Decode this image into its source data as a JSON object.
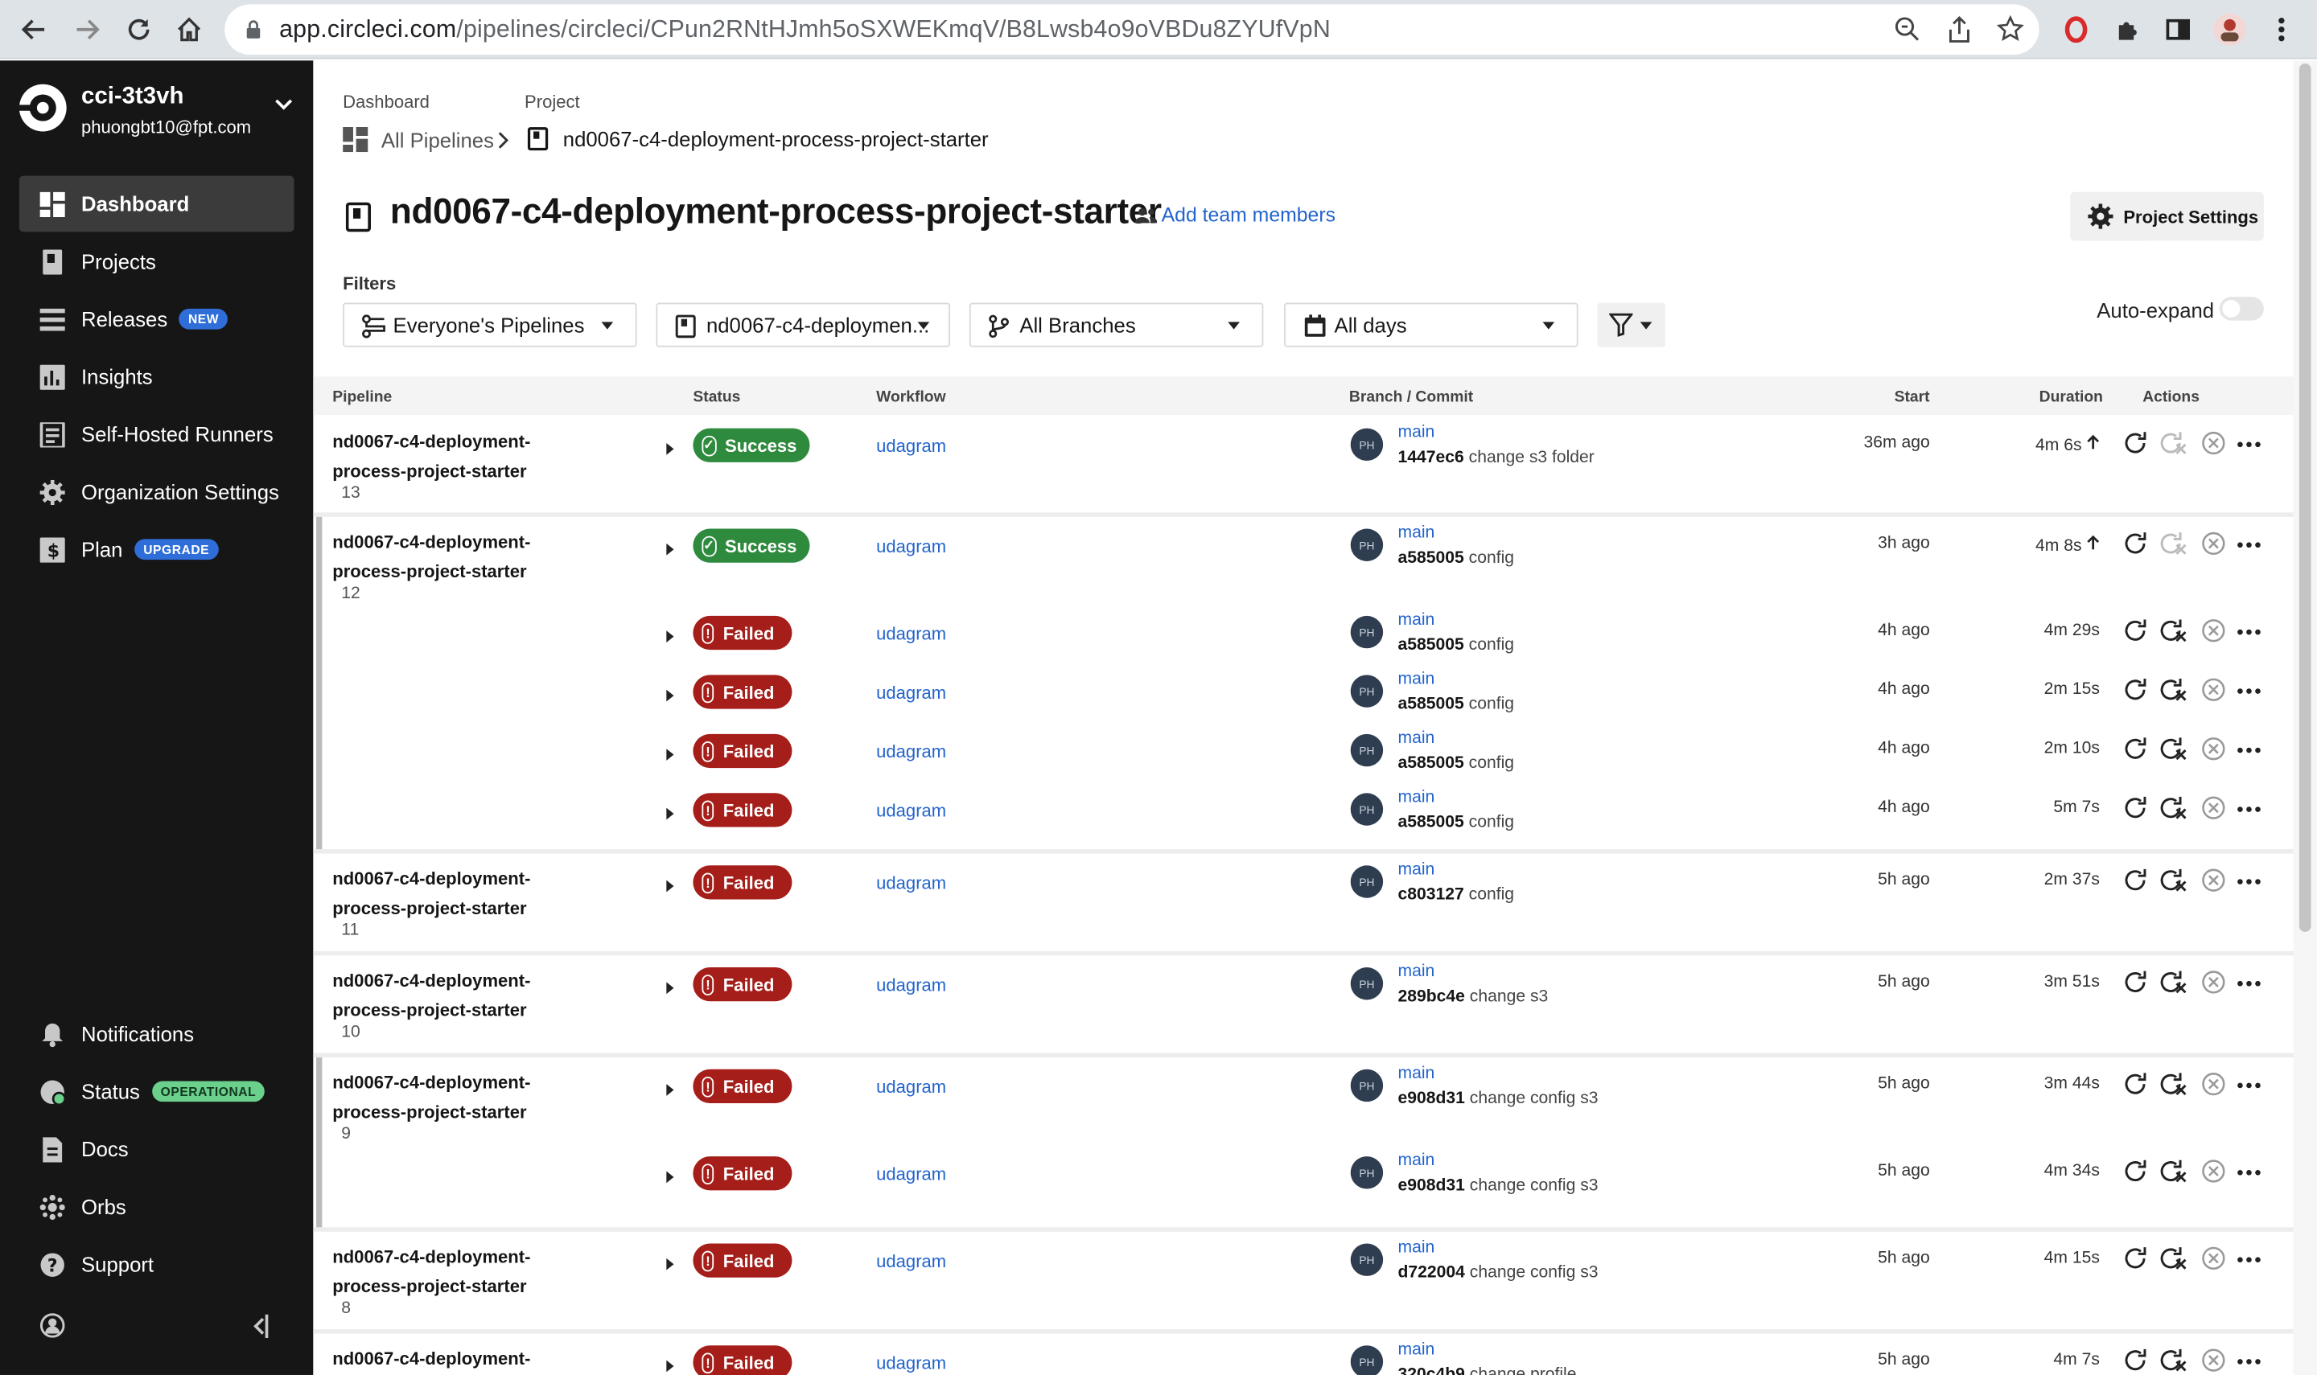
{
  "browser": {
    "url_host": "app.circleci.com",
    "url_path": "/pipelines/circleci/CPun2RNtHJmh5oSXWEKmqV/B8Lwsb4o9oVBDu8ZYUfVpN"
  },
  "sidebar": {
    "org_name": "cci-3t3vh",
    "org_email": "phuongbt10@fpt.com",
    "items": [
      {
        "label": "Dashboard"
      },
      {
        "label": "Projects"
      },
      {
        "label": "Releases",
        "badge": "NEW"
      },
      {
        "label": "Insights"
      },
      {
        "label": "Self-Hosted Runners"
      },
      {
        "label": "Organization Settings"
      },
      {
        "label": "Plan",
        "badge": "UPGRADE"
      }
    ],
    "bottom": [
      {
        "label": "Notifications"
      },
      {
        "label": "Status",
        "badge": "OPERATIONAL"
      },
      {
        "label": "Docs"
      },
      {
        "label": "Orbs"
      },
      {
        "label": "Support"
      }
    ]
  },
  "breadcrumb": {
    "dashboard_label": "Dashboard",
    "project_label": "Project",
    "all_pipelines": "All Pipelines",
    "project": "nd0067-c4-deployment-process-project-starter"
  },
  "header": {
    "title": "nd0067-c4-deployment-process-project-starter",
    "add_team": "Add team members",
    "settings": "Project Settings"
  },
  "filters": {
    "label": "Filters",
    "pipelines": "Everyone's Pipelines",
    "project": "nd0067-c4-deploymen...",
    "branches": "All Branches",
    "days": "All days",
    "auto_expand": "Auto-expand"
  },
  "table": {
    "headers": {
      "pipeline": "Pipeline",
      "status": "Status",
      "workflow": "Workflow",
      "branch": "Branch / Commit",
      "start": "Start",
      "duration": "Duration",
      "actions": "Actions"
    },
    "avatar": "PH",
    "groups": [
      {
        "name": "nd0067-c4-deployment-process-project-starter",
        "number": "13",
        "rows": [
          {
            "status": "Success",
            "workflow": "udagram",
            "branch": "main",
            "sha": "1447ec6",
            "msg": "change s3 folder",
            "start": "36m ago",
            "duration": "4m 6s",
            "faster": true
          }
        ]
      },
      {
        "name": "nd0067-c4-deployment-process-project-starter",
        "number": "12",
        "rows": [
          {
            "status": "Success",
            "workflow": "udagram",
            "branch": "main",
            "sha": "a585005",
            "msg": "config",
            "start": "3h ago",
            "duration": "4m 8s",
            "faster": true
          },
          {
            "status": "Failed",
            "workflow": "udagram",
            "branch": "main",
            "sha": "a585005",
            "msg": "config",
            "start": "4h ago",
            "duration": "4m 29s"
          },
          {
            "status": "Failed",
            "workflow": "udagram",
            "branch": "main",
            "sha": "a585005",
            "msg": "config",
            "start": "4h ago",
            "duration": "2m 15s"
          },
          {
            "status": "Failed",
            "workflow": "udagram",
            "branch": "main",
            "sha": "a585005",
            "msg": "config",
            "start": "4h ago",
            "duration": "2m 10s"
          },
          {
            "status": "Failed",
            "workflow": "udagram",
            "branch": "main",
            "sha": "a585005",
            "msg": "config",
            "start": "4h ago",
            "duration": "5m 7s"
          }
        ]
      },
      {
        "name": "nd0067-c4-deployment-process-project-starter",
        "number": "11",
        "rows": [
          {
            "status": "Failed",
            "workflow": "udagram",
            "branch": "main",
            "sha": "c803127",
            "msg": "config",
            "start": "5h ago",
            "duration": "2m 37s"
          }
        ]
      },
      {
        "name": "nd0067-c4-deployment-process-project-starter",
        "number": "10",
        "rows": [
          {
            "status": "Failed",
            "workflow": "udagram",
            "branch": "main",
            "sha": "289bc4e",
            "msg": "change s3",
            "start": "5h ago",
            "duration": "3m 51s"
          }
        ]
      },
      {
        "name": "nd0067-c4-deployment-process-project-starter",
        "number": "9",
        "rows": [
          {
            "status": "Failed",
            "workflow": "udagram",
            "branch": "main",
            "sha": "e908d31",
            "msg": "change config s3",
            "start": "5h ago",
            "duration": "3m 44s"
          },
          {
            "status": "Failed",
            "workflow": "udagram",
            "branch": "main",
            "sha": "e908d31",
            "msg": "change config s3",
            "start": "5h ago",
            "duration": "4m 34s"
          }
        ]
      },
      {
        "name": "nd0067-c4-deployment-process-project-starter",
        "number": "8",
        "rows": [
          {
            "status": "Failed",
            "workflow": "udagram",
            "branch": "main",
            "sha": "d722004",
            "msg": "change config s3",
            "start": "5h ago",
            "duration": "4m 15s"
          }
        ]
      },
      {
        "name": "nd0067-c4-deployment-process-project-starter",
        "number": "",
        "rows": [
          {
            "status": "Failed",
            "workflow": "udagram",
            "branch": "main",
            "sha": "320c4b9",
            "msg": "change profile",
            "start": "5h ago",
            "duration": "4m 7s"
          }
        ]
      }
    ]
  },
  "colors": {
    "success": "#2e8a3d",
    "failed": "#a51e1a",
    "link": "#2364cc",
    "sidebar": "#161616"
  }
}
